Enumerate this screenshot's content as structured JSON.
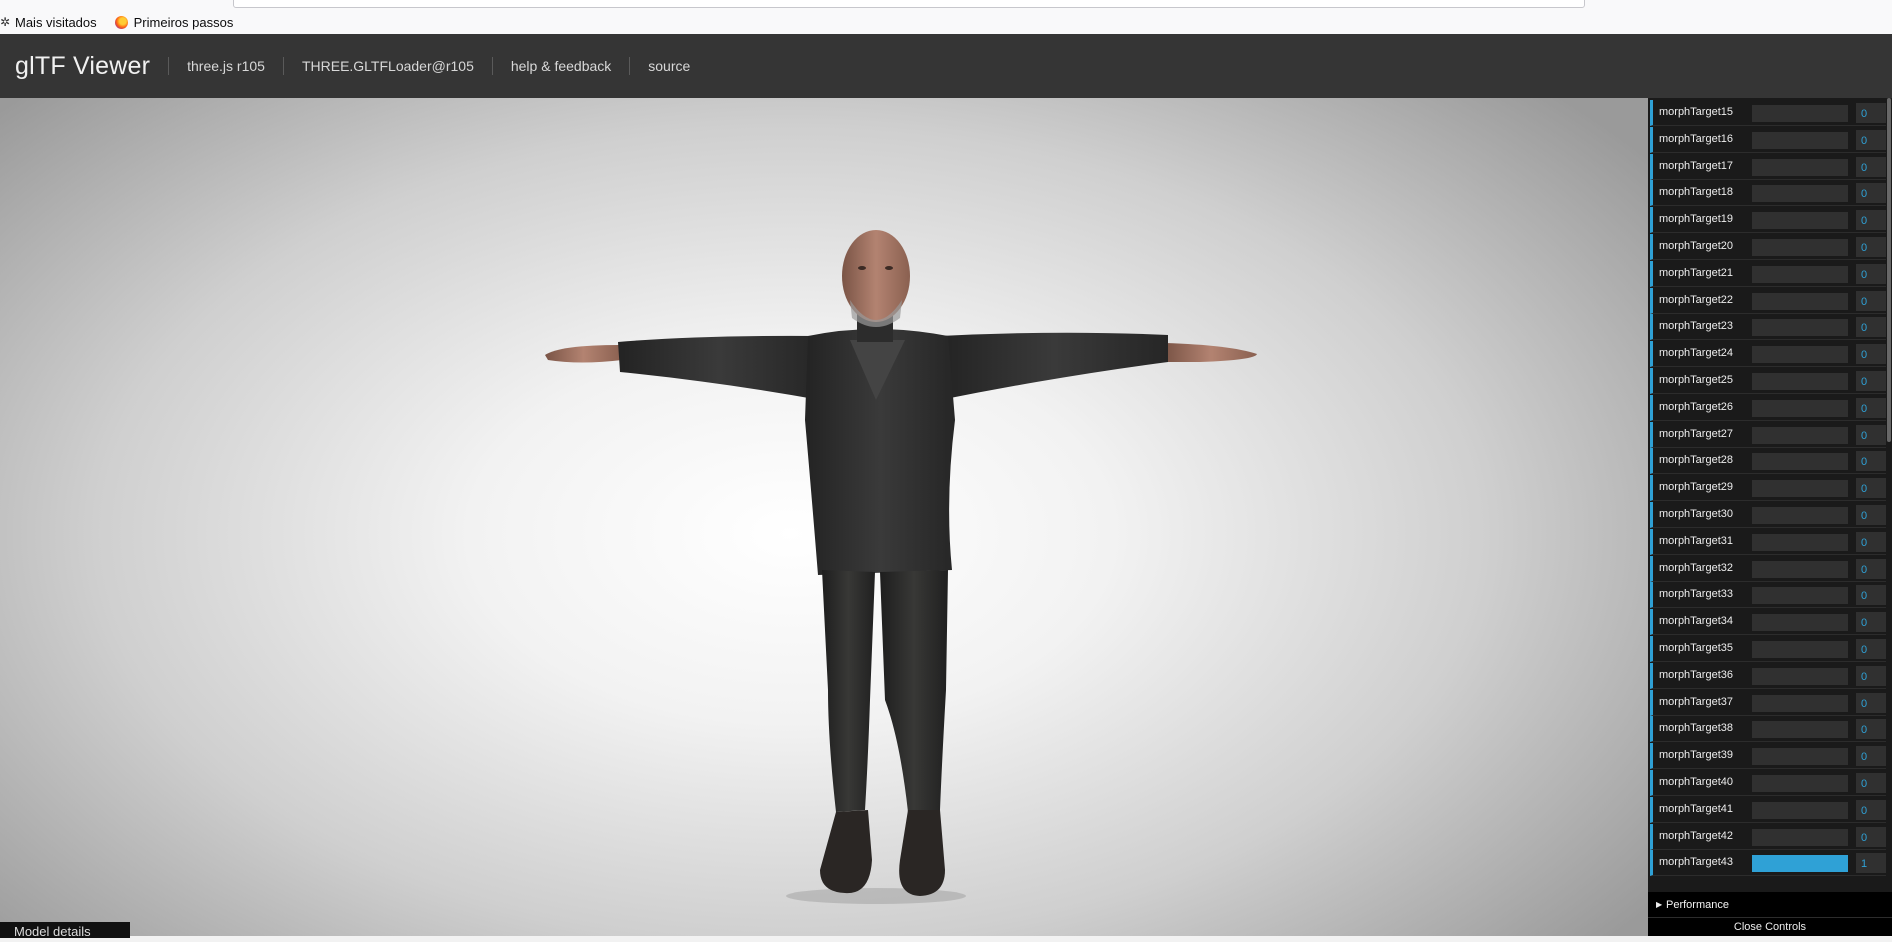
{
  "browser": {
    "bookmarks": [
      {
        "label": "Mais visitados",
        "icon": "gear-icon"
      },
      {
        "label": "Primeiros passos",
        "icon": "firefox-icon"
      }
    ]
  },
  "header": {
    "title": "glTF Viewer",
    "nav": [
      {
        "label": "three.js r105"
      },
      {
        "label": "THREE.GLTFLoader@r105"
      },
      {
        "label": "help & feedback"
      },
      {
        "label": "source"
      }
    ]
  },
  "controls": {
    "accent": "#2fa1d6",
    "rows": [
      {
        "label": "morphTarget15",
        "value": "0",
        "fill": 0
      },
      {
        "label": "morphTarget16",
        "value": "0",
        "fill": 0
      },
      {
        "label": "morphTarget17",
        "value": "0",
        "fill": 0
      },
      {
        "label": "morphTarget18",
        "value": "0",
        "fill": 0
      },
      {
        "label": "morphTarget19",
        "value": "0",
        "fill": 0
      },
      {
        "label": "morphTarget20",
        "value": "0",
        "fill": 0
      },
      {
        "label": "morphTarget21",
        "value": "0",
        "fill": 0
      },
      {
        "label": "morphTarget22",
        "value": "0",
        "fill": 0
      },
      {
        "label": "morphTarget23",
        "value": "0",
        "fill": 0
      },
      {
        "label": "morphTarget24",
        "value": "0",
        "fill": 0
      },
      {
        "label": "morphTarget25",
        "value": "0",
        "fill": 0
      },
      {
        "label": "morphTarget26",
        "value": "0",
        "fill": 0
      },
      {
        "label": "morphTarget27",
        "value": "0",
        "fill": 0
      },
      {
        "label": "morphTarget28",
        "value": "0",
        "fill": 0
      },
      {
        "label": "morphTarget29",
        "value": "0",
        "fill": 0
      },
      {
        "label": "morphTarget30",
        "value": "0",
        "fill": 0
      },
      {
        "label": "morphTarget31",
        "value": "0",
        "fill": 0
      },
      {
        "label": "morphTarget32",
        "value": "0",
        "fill": 0
      },
      {
        "label": "morphTarget33",
        "value": "0",
        "fill": 0
      },
      {
        "label": "morphTarget34",
        "value": "0",
        "fill": 0
      },
      {
        "label": "morphTarget35",
        "value": "0",
        "fill": 0
      },
      {
        "label": "morphTarget36",
        "value": "0",
        "fill": 0
      },
      {
        "label": "morphTarget37",
        "value": "0",
        "fill": 0
      },
      {
        "label": "morphTarget38",
        "value": "0",
        "fill": 0
      },
      {
        "label": "morphTarget39",
        "value": "0",
        "fill": 0
      },
      {
        "label": "morphTarget40",
        "value": "0",
        "fill": 0
      },
      {
        "label": "morphTarget41",
        "value": "0",
        "fill": 0
      },
      {
        "label": "morphTarget42",
        "value": "0",
        "fill": 0
      },
      {
        "label": "morphTarget43",
        "value": "1",
        "fill": 1
      }
    ],
    "performance_label": "Performance",
    "close_label": "Close Controls"
  },
  "footer": {
    "model_details_label": "Model details"
  }
}
